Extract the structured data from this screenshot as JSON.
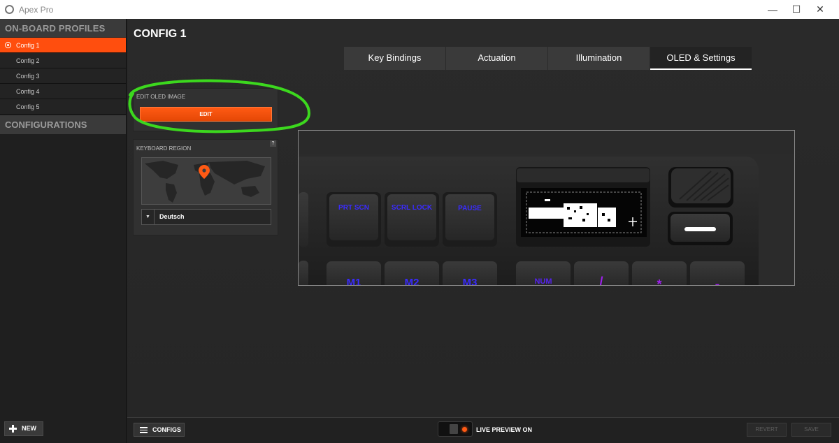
{
  "window": {
    "title": "Apex Pro",
    "minimize": "—",
    "maximize": "☐",
    "close": "✕"
  },
  "sidebar": {
    "profiles_header": "ON-BOARD PROFILES",
    "items": [
      {
        "label": "Config 1",
        "active": true
      },
      {
        "label": "Config 2"
      },
      {
        "label": "Config 3"
      },
      {
        "label": "Config 4"
      },
      {
        "label": "Config 5"
      }
    ],
    "configurations_header": "CONFIGURATIONS",
    "new_label": "NEW"
  },
  "main": {
    "title": "CONFIG 1",
    "tabs": [
      {
        "label": "Key Bindings"
      },
      {
        "label": "Actuation"
      },
      {
        "label": "Illumination"
      },
      {
        "label": "OLED & Settings",
        "active": true
      }
    ],
    "oled_panel": {
      "label": "EDIT OLED IMAGE",
      "button": "EDIT"
    },
    "region_panel": {
      "label": "KEYBOARD REGION",
      "help": "?",
      "selected": "Deutsch"
    },
    "keys": {
      "prtscn": "PRT SCN",
      "scrlock": "SCRL LOCK",
      "pause": "PAUSE",
      "m1": "M1",
      "m2": "M2",
      "m3": "M3",
      "num": "NUM",
      "slash": "/",
      "asterisk": "*",
      "minus": "-"
    }
  },
  "bottom": {
    "configs_label": "CONFIGS",
    "live_preview": "LIVE PREVIEW ON",
    "revert": "REVERT",
    "save": "SAVE"
  },
  "colors": {
    "accent": "#ff4e0e",
    "highlight_circle": "#3cd81e",
    "key_legend": "#3a2bff",
    "key_legend_purple": "#a020f0"
  }
}
